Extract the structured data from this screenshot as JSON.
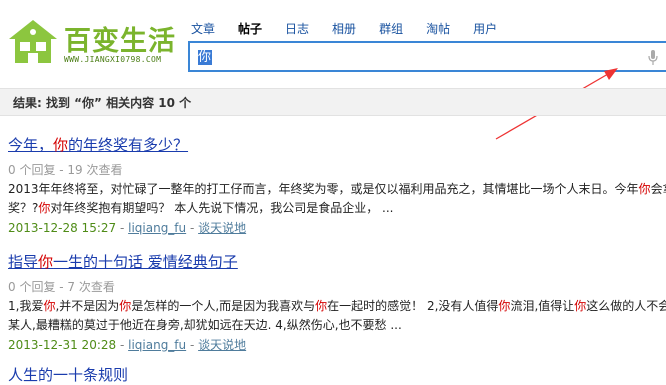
{
  "logo": {
    "text": "百变生活",
    "url": "WWW.JIANGXI0798.COM",
    "icon": "house-icon"
  },
  "nav": {
    "tabs": [
      {
        "label": "文章",
        "active": false
      },
      {
        "label": "帖子",
        "active": true
      },
      {
        "label": "日志",
        "active": false
      },
      {
        "label": "相册",
        "active": false
      },
      {
        "label": "群组",
        "active": false
      },
      {
        "label": "淘帖",
        "active": false
      },
      {
        "label": "用户",
        "active": false
      }
    ]
  },
  "search": {
    "value": "你",
    "icon": "microphone-icon"
  },
  "summary": {
    "text": "结果: 找到 “你” 相关内容 10 个"
  },
  "results": [
    {
      "title_pre": "今年，",
      "title_hl": "你",
      "title_post": "的年终奖有多少？",
      "meta": "0 个回复 - 19 次查看",
      "snippet1_parts": [
        {
          "t": "2013年年终将至，对忙碌了一整年的打工仔而言，年终奖为零，或是仅以福利用品充之，其情堪比一场个人末日。今年"
        },
        {
          "t": "你",
          "hl": true
        },
        {
          "t": "会拿"
        }
      ],
      "snippet2_parts": [
        {
          "t": "奖？?"
        },
        {
          "t": "你",
          "hl": true
        },
        {
          "t": "对年终奖抱有期望吗？ 本人先说下情况，我公司是食品企业， ..."
        }
      ],
      "date": "2013-12-28 15:27",
      "author": "liqiang_fu",
      "forum": "谈天说地"
    },
    {
      "title_pre": "指导",
      "title_hl": "你",
      "title_post": "一生的十句话 爱情经典句子",
      "meta": "0 个回复 - 7 次查看",
      "snippet1_parts": [
        {
          "t": "1,我爱"
        },
        {
          "t": "你",
          "hl": true
        },
        {
          "t": ",并不是因为"
        },
        {
          "t": "你",
          "hl": true
        },
        {
          "t": "是怎样的一个人,而是因为我喜欢与"
        },
        {
          "t": "你",
          "hl": true
        },
        {
          "t": "在一起时的感觉！ 2,没有人值得"
        },
        {
          "t": "你",
          "hl": true
        },
        {
          "t": "流泪,值得让"
        },
        {
          "t": "你",
          "hl": true
        },
        {
          "t": "这么做的人不会让"
        }
      ],
      "snippet2_parts": [
        {
          "t": "某人,最糟糕的莫过于他近在身旁,却犹如远在天边. 4,纵然伤心,也不要愁 ..."
        }
      ],
      "date": "2013-12-31 20:28",
      "author": "liqiang_fu",
      "forum": "谈天说地"
    }
  ],
  "third_result_title": "人生的一十条规则"
}
